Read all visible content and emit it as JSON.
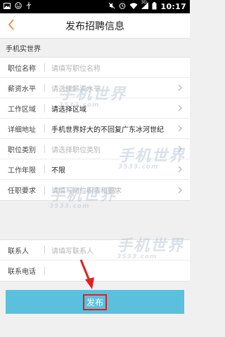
{
  "status_bar": {
    "time": "10:17",
    "network": "3G",
    "icons": [
      "image-icon",
      "smile-icon",
      "usb-icon",
      "mute-icon",
      "alarm-icon",
      "wifi-icon",
      "signal-icon",
      "battery-icon"
    ]
  },
  "header": {
    "title": "发布招聘信息",
    "back_icon": "chevron-left-icon"
  },
  "company": {
    "name": "手机实世界"
  },
  "form": {
    "group1": [
      {
        "key": "job_name",
        "label": "职位名称",
        "value": "",
        "placeholder": "请填写职位名称",
        "has_arrow": false
      },
      {
        "key": "salary",
        "label": "薪资水平",
        "value": "",
        "placeholder": "请选择薪资水平",
        "has_arrow": true
      },
      {
        "key": "work_area",
        "label": "工作区域",
        "value": "请选择区域",
        "placeholder": "",
        "has_arrow": true
      },
      {
        "key": "address",
        "label": "详细地址",
        "value": "手机世界好大的不回复广东冰河世纪",
        "placeholder": "",
        "has_arrow": true
      },
      {
        "key": "job_type",
        "label": "职位类别",
        "value": "",
        "placeholder": "请选择职位类别",
        "has_arrow": true
      },
      {
        "key": "years",
        "label": "工作年限",
        "value": "不限",
        "placeholder": "",
        "has_arrow": true
      },
      {
        "key": "requirements",
        "label": "任职要求",
        "value": "",
        "placeholder": "请填写岗位职责和要求",
        "has_arrow": true
      }
    ],
    "group2": [
      {
        "key": "contact",
        "label": "联系人",
        "value": "",
        "placeholder": "请填写联系人",
        "has_arrow": false
      },
      {
        "key": "phone",
        "label": "联系电话",
        "value": "",
        "placeholder": "",
        "has_arrow": false
      }
    ]
  },
  "submit": {
    "label": "发布"
  },
  "watermark": {
    "text": "手机世界",
    "sub": "3533.com"
  },
  "colors": {
    "submit_bg": "#5bc0de",
    "highlight": "#e02020",
    "back_accent": "#f08a3c"
  }
}
